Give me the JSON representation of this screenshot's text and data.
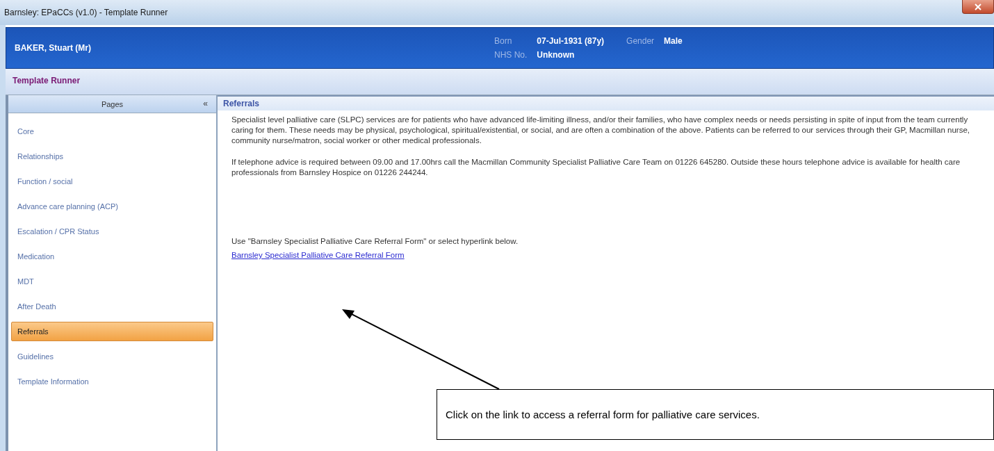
{
  "window": {
    "title": "Barnsley: EPaCCs (v1.0) - Template Runner"
  },
  "patient": {
    "name": "BAKER, Stuart (Mr)",
    "fields": [
      {
        "label": "Born",
        "value": "07-Jul-1931 (87y)"
      },
      {
        "label": "Gender",
        "value": "Male"
      },
      {
        "label": "NHS No.",
        "value": "Unknown"
      }
    ]
  },
  "section_title": "Template Runner",
  "sidebar": {
    "title": "Pages",
    "collapse": "«",
    "items": [
      {
        "label": "Core",
        "selected": false
      },
      {
        "label": "Relationships",
        "selected": false
      },
      {
        "label": "Function / social",
        "selected": false
      },
      {
        "label": "Advance care planning (ACP)",
        "selected": false
      },
      {
        "label": "Escalation / CPR Status",
        "selected": false
      },
      {
        "label": "Medication",
        "selected": false
      },
      {
        "label": "MDT",
        "selected": false
      },
      {
        "label": "After Death",
        "selected": false
      },
      {
        "label": "Referrals",
        "selected": true
      },
      {
        "label": "Guidelines",
        "selected": false
      },
      {
        "label": "Template Information",
        "selected": false
      }
    ]
  },
  "content": {
    "title": "Referrals",
    "paragraphs": [
      "Specialist level palliative care (SLPC) services are for patients who have advanced life-limiting illness, and/or their families, who have complex needs or needs persisting in spite of input from the team currently caring for them. These needs may be physical, psychological, spiritual/existential, or social, and are often a combination of the above. Patients can be referred to our services through their GP, Macmillan nurse, community nurse/matron, social worker or other medical professionals.",
      "If telephone advice is required between 09.00 and 17.00hrs call the Macmillan Community Specialist Palliative Care Team on 01226 645280. Outside these hours telephone advice is available for health care professionals from Barnsley Hospice on 01226 244244."
    ],
    "instruction": "Use \"Barnsley Specialist Palliative Care Referral Form\" or select hyperlink below.",
    "link": "Barnsley Specialist Palliative Care Referral Form"
  },
  "callout": {
    "text": "Click on the link to access a referral form for palliative care services."
  }
}
